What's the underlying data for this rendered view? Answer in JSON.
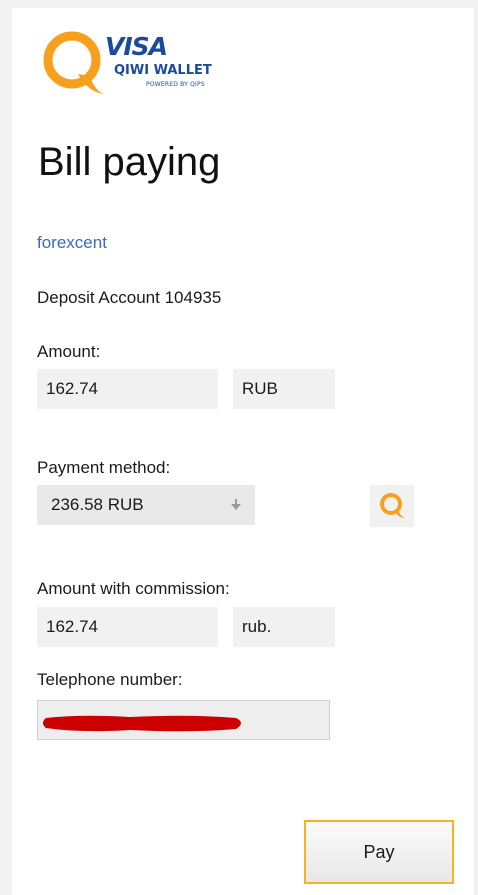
{
  "logo": {
    "brand_top": "VISA",
    "brand_bottom": "QIWI WALLET",
    "powered_by": "POWERED BY QIPS"
  },
  "page": {
    "title": "Bill paying"
  },
  "merchant": {
    "name": "forexcent"
  },
  "account": {
    "description": "Deposit Account 104935"
  },
  "amount": {
    "label": "Amount:",
    "value": "162.74",
    "currency": "RUB"
  },
  "payment_method": {
    "label": "Payment method:",
    "selected": "236.58 RUB",
    "icon": "qiwi-q-icon"
  },
  "commission": {
    "label": "Amount with commission:",
    "value": "162.74",
    "currency": "rub."
  },
  "phone": {
    "label": "Telephone number:",
    "value_redacted": true
  },
  "actions": {
    "pay_label": "Pay"
  },
  "colors": {
    "brand_blue": "#1a4a9e",
    "qiwi_orange": "#f7a01e",
    "link_blue": "#3a6bbf",
    "pay_border": "#f5b324",
    "redaction_red": "#cc0000"
  }
}
